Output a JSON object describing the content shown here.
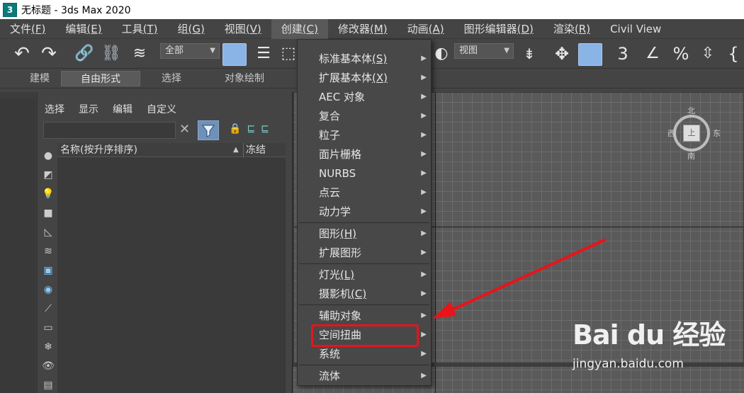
{
  "titlebar": {
    "icon_text": "3",
    "title": "无标题 - 3ds Max 2020"
  },
  "menubar": {
    "items": [
      {
        "label": "文件",
        "mnemonic": "(F)"
      },
      {
        "label": "编辑",
        "mnemonic": "(E)"
      },
      {
        "label": "工具",
        "mnemonic": "(T)"
      },
      {
        "label": "组",
        "mnemonic": "(G)"
      },
      {
        "label": "视图",
        "mnemonic": "(V)"
      },
      {
        "label": "创建",
        "mnemonic": "(C)"
      },
      {
        "label": "修改器",
        "mnemonic": "(M)"
      },
      {
        "label": "动画",
        "mnemonic": "(A)"
      },
      {
        "label": "图形编辑器",
        "mnemonic": "(D)"
      },
      {
        "label": "渲染",
        "mnemonic": "(R)"
      },
      {
        "label": "Civil View",
        "mnemonic": ""
      }
    ]
  },
  "toolbar": {
    "selection_filter": "全部",
    "view_select": "视图"
  },
  "ribbon": {
    "tabs": [
      "建模",
      "自由形式",
      "选择",
      "对象绘制"
    ]
  },
  "panel": {
    "tabs": [
      "选择",
      "显示",
      "编辑",
      "自定义"
    ],
    "search_value": "",
    "column_name": "名称(按升序排序)",
    "sort_indicator": "▲",
    "column_freeze": "冻结"
  },
  "viewcube": {
    "north": "北",
    "south": "南",
    "east": "东",
    "west": "西",
    "face": "上"
  },
  "dropdown": {
    "items": [
      {
        "label": "标准基本体",
        "mnemonic": "(S)",
        "submenu": true
      },
      {
        "label": "扩展基本体",
        "mnemonic": "(X)",
        "submenu": true
      },
      {
        "label": "AEC 对象",
        "mnemonic": "",
        "submenu": true
      },
      {
        "label": "复合",
        "mnemonic": "",
        "submenu": true
      },
      {
        "label": "粒子",
        "mnemonic": "",
        "submenu": true
      },
      {
        "label": "面片栅格",
        "mnemonic": "",
        "submenu": true
      },
      {
        "label": "NURBS",
        "mnemonic": "",
        "submenu": true
      },
      {
        "label": "点云",
        "mnemonic": "",
        "submenu": true
      },
      {
        "label": "动力学",
        "mnemonic": "",
        "submenu": true
      },
      {
        "label": "图形",
        "mnemonic": "(H)",
        "submenu": true
      },
      {
        "label": "扩展图形",
        "mnemonic": "",
        "submenu": true
      },
      {
        "label": "灯光",
        "mnemonic": "(L)",
        "submenu": true
      },
      {
        "label": "摄影机",
        "mnemonic": "(C)",
        "submenu": true
      },
      {
        "label": "辅助对象",
        "mnemonic": "",
        "submenu": true
      },
      {
        "label": "空间扭曲",
        "mnemonic": "",
        "submenu": true
      },
      {
        "label": "系统",
        "mnemonic": "",
        "submenu": true
      },
      {
        "label": "流体",
        "mnemonic": "",
        "submenu": true
      }
    ]
  },
  "watermark": {
    "logo": "Bai du 经验",
    "url": "jingyan.baidu.com"
  },
  "colors": {
    "highlight_red": "#e8141a",
    "accent_blue": "#8ab4e6"
  }
}
